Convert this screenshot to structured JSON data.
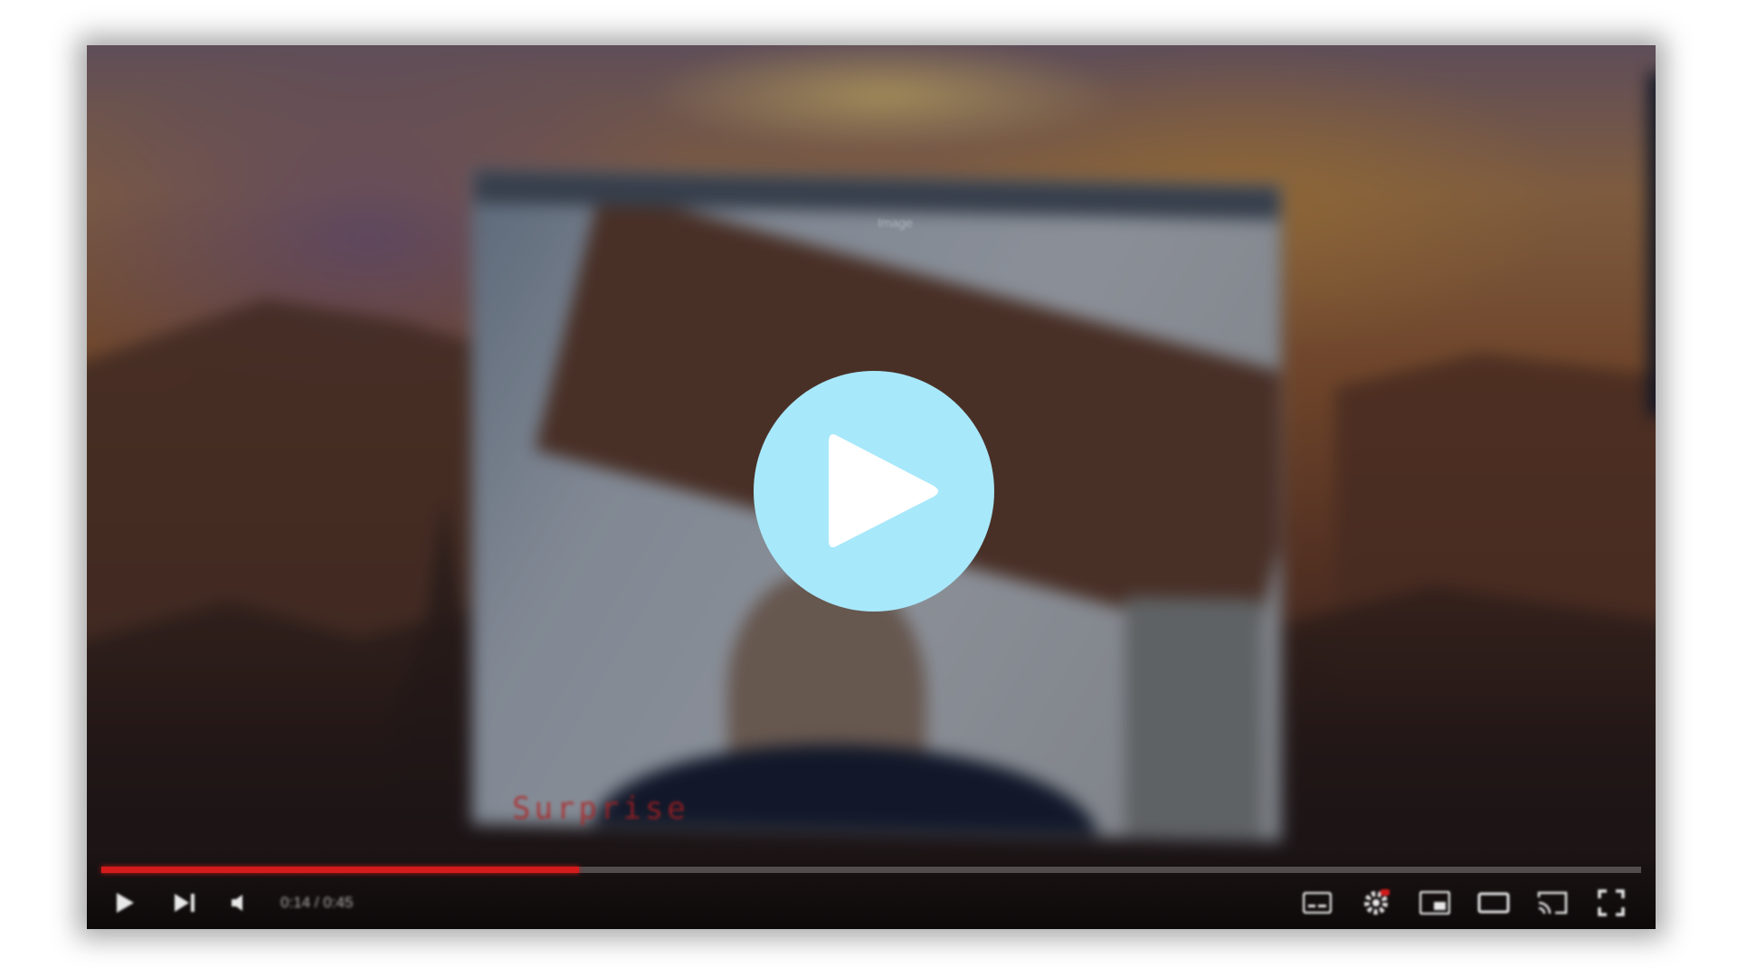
{
  "video": {
    "overlay_label": "Surprise",
    "window_title": "Image",
    "current_time": "0:14",
    "duration": "0:45",
    "time_display": "0:14 / 0:45",
    "progress": 0.31
  },
  "controls": {
    "play": "play-icon",
    "next": "next-icon",
    "volume": "volume-icon",
    "subtitles": "subtitles-icon",
    "settings": "gear-icon",
    "miniplayer": "miniplayer-icon",
    "theater": "theater-icon",
    "cast": "cast-icon",
    "fullscreen": "fullscreen-icon"
  },
  "colors": {
    "accent": "#d41b1b",
    "play_button": "#a8e8fb"
  }
}
